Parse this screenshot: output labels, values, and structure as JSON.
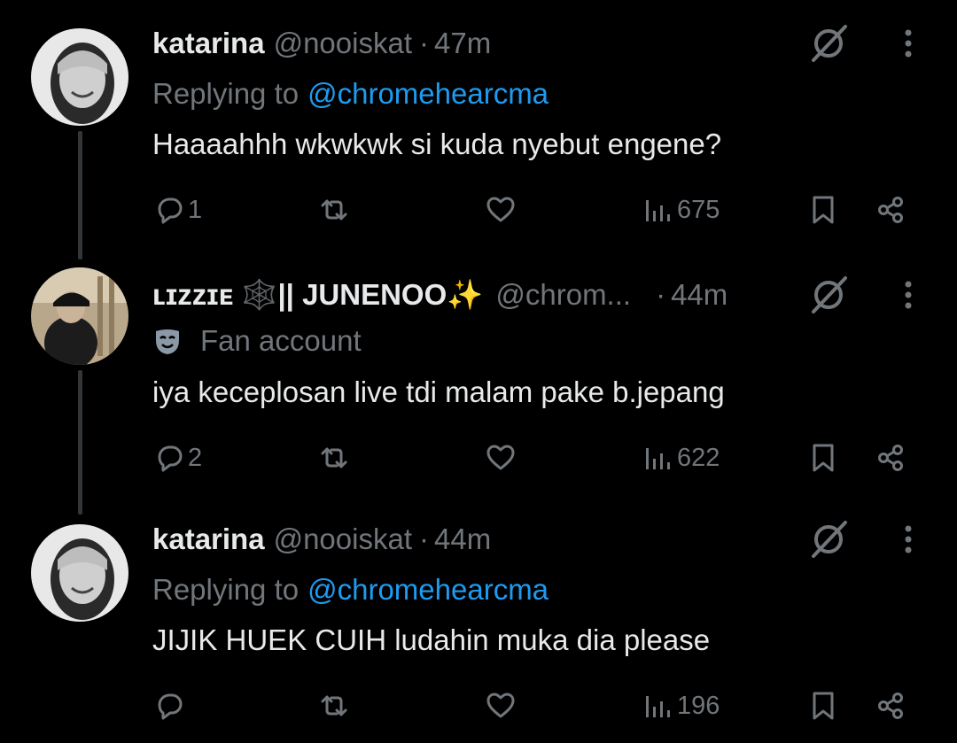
{
  "tweets": [
    {
      "name": "katarina",
      "handle": "@nooiskat",
      "separator": "·",
      "time": "47m",
      "replying_label": "Replying to",
      "replying_handle": "@chromehearcma",
      "text": "Haaaahhh wkwkwk si kuda nyebut engene?",
      "replies": "1",
      "views": "675"
    },
    {
      "name": "ʟɪᴢᴢɪᴇ 🕸️|| JUNENOO✨",
      "handle": "@chrom...",
      "separator": "·",
      "time": "44m",
      "label": "Fan account",
      "text": "iya keceplosan live tdi malam pake b.jepang",
      "replies": "2",
      "views": "622"
    },
    {
      "name": "katarina",
      "handle": "@nooiskat",
      "separator": "·",
      "time": "44m",
      "replying_label": "Replying to",
      "replying_handle": "@chromehearcma",
      "text": "JIJIK HUEK CUIH ludahin muka dia please",
      "replies": "",
      "views": "196"
    }
  ],
  "icons": {
    "reply": "reply-icon",
    "retweet": "retweet-icon",
    "like": "heart-icon",
    "views": "views-icon",
    "bookmark": "bookmark-icon",
    "share": "share-icon",
    "grok": "grok-icon",
    "more": "more-icon",
    "fan": "theater-masks-icon"
  },
  "colors": {
    "background": "#000000",
    "text": "#e7e9ea",
    "muted": "#71767b",
    "link": "#1d9bf0",
    "thread_line": "#333639"
  }
}
